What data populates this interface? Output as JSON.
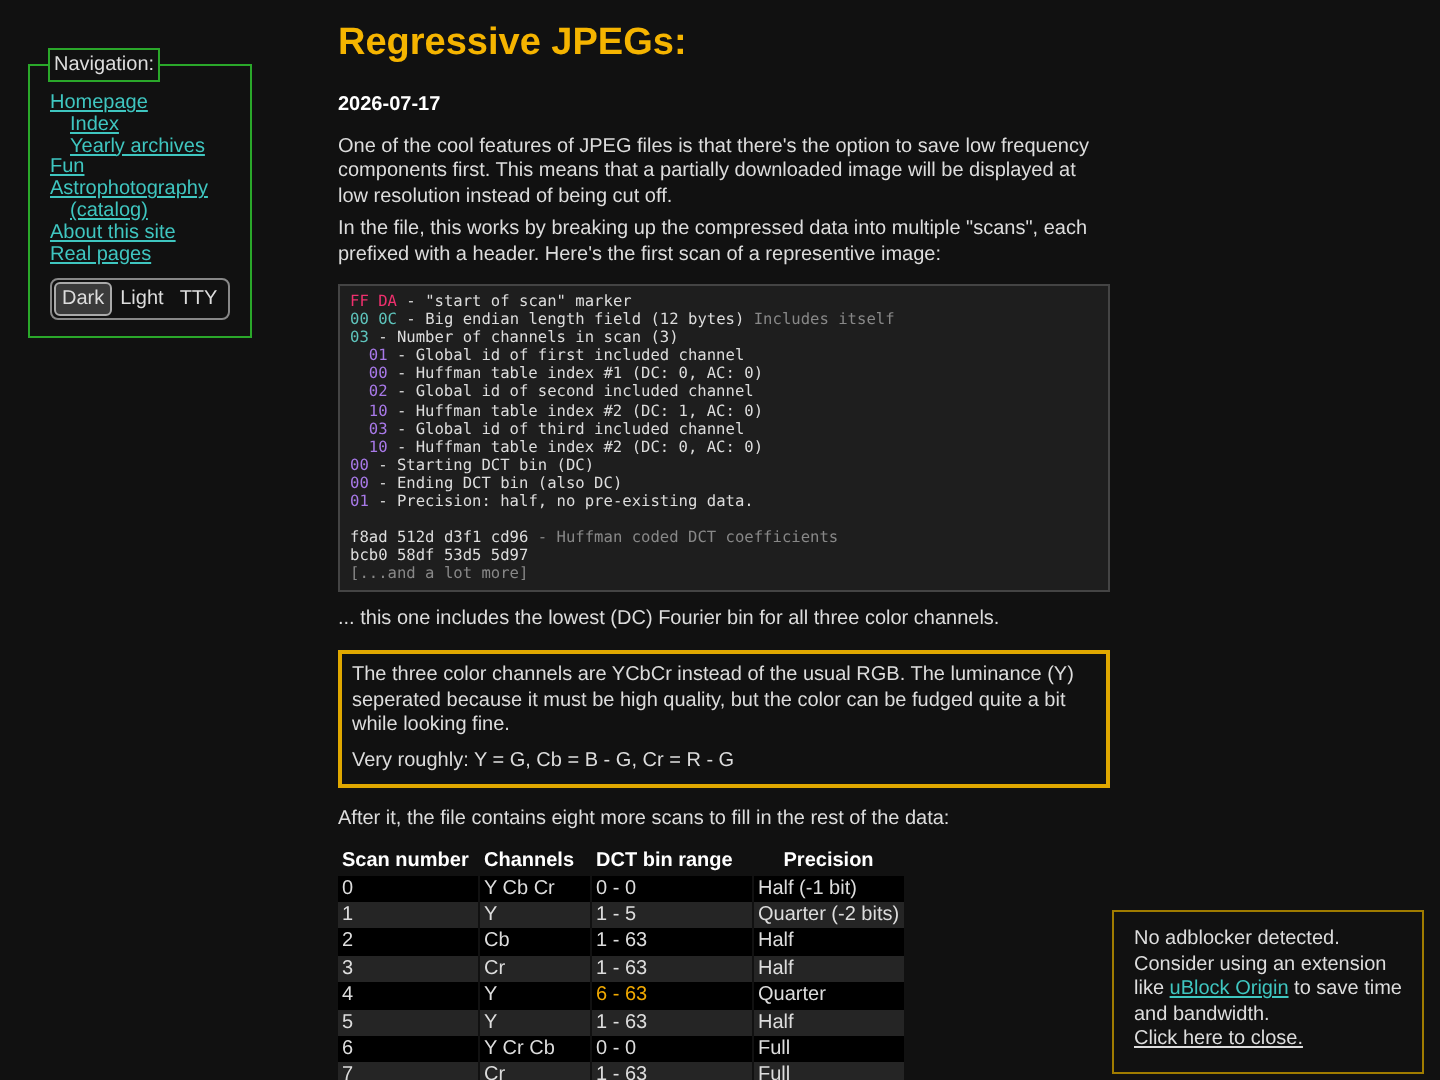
{
  "navigation": {
    "title": "Navigation:",
    "links": [
      {
        "label": "Homepage",
        "children": [
          {
            "label": "Index"
          },
          {
            "label": "Yearly archives"
          }
        ]
      },
      {
        "label": "Fun"
      },
      {
        "label": "Astrophotography",
        "children": [
          {
            "label": "(catalog)"
          }
        ]
      },
      {
        "label": "About this site"
      },
      {
        "label": "Real pages"
      }
    ],
    "themes": [
      {
        "label": "Dark",
        "selected": true
      },
      {
        "label": "Light",
        "selected": false
      },
      {
        "label": "TTY",
        "selected": false
      }
    ]
  },
  "article": {
    "title": "Regressive JPEGs:",
    "date": "2026-07-17",
    "intro": [
      "One of the cool features of JPEG files is that there's the option to save low frequency components first. This means that a partially downloaded image will be displayed at low resolution instead of being cut off.",
      "In the file, this works by breaking up the compressed data into multiple \"scans\", each prefixed with a header. Here's the first scan of a representive image:"
    ],
    "code": [
      {
        "kind": "field",
        "hex": "FF DA",
        "color": "#f0306e",
        "text": " - \"start of scan\" marker"
      },
      {
        "kind": "field",
        "hex": "00 0C",
        "color": "#5ec4bc",
        "text": " - Big endian length field (12 bytes)",
        "note": " Includes itself"
      },
      {
        "kind": "field",
        "hex": "03",
        "color": "#5ec4bc",
        "text": " - Number of channels in scan (3)",
        "children": [
          {
            "kind": "field",
            "hex": "01",
            "color": "#a879e8",
            "text": " - Global id of first included channel"
          },
          {
            "kind": "field",
            "hex": "00",
            "color": "#a879e8",
            "text": " - Huffman table index #1 (DC: 0, AC: 0)"
          },
          {
            "kind": "field",
            "hex": "02",
            "color": "#a879e8",
            "text": " - Global id of second included channel"
          },
          {
            "kind": "field",
            "hex": "10",
            "color": "#a879e8",
            "text": " - Huffman table index #2 (DC: 1, AC: 0)"
          },
          {
            "kind": "field",
            "hex": "03",
            "color": "#a879e8",
            "text": " - Global id of third included channel"
          },
          {
            "kind": "field",
            "hex": "10",
            "color": "#a879e8",
            "text": " - Huffman table index #2 (DC: 0, AC: 0)"
          }
        ]
      },
      {
        "kind": "field",
        "hex": "00",
        "color": "#a879e8",
        "text": " - Starting DCT bin (DC)"
      },
      {
        "kind": "field",
        "hex": "00",
        "color": "#a879e8",
        "text": " - Ending DCT bin (also DC)"
      },
      {
        "kind": "field",
        "hex": "01",
        "color": "#a879e8",
        "text": " - Precision: half, no pre-existing data."
      },
      {
        "kind": "blank"
      },
      {
        "kind": "data",
        "text": "f8ad 512d d3f1 cd96",
        "note": " - Huffman coded DCT coefficients"
      },
      {
        "kind": "data",
        "text": "bcb0 58df 53d5 5d97"
      },
      {
        "kind": "note",
        "text": "[...and a lot more]"
      }
    ],
    "after_code": "... this one includes the lowest (DC) Fourier bin for all three color channels.",
    "callout": [
      "The three color channels are YCbCr instead of the usual RGB. The luminance (Y) seperated because it must be high quality, but the color can be fudged quite a bit while looking fine.",
      "Very roughly: Y = G, Cb = B - G, Cr = R - G"
    ],
    "table_intro": "After it, the file contains eight more scans to fill in the rest of the data:",
    "table": {
      "columns": [
        "Scan number",
        "Channels",
        "DCT bin range",
        "Precision"
      ],
      "rows": [
        [
          {
            "text": "0",
            "highlighted": false
          },
          {
            "text": "Y Cb Cr",
            "highlighted": false
          },
          {
            "text": "0 - 0",
            "highlighted": false
          },
          {
            "text": "Half (-1 bit)",
            "highlighted": false
          }
        ],
        [
          {
            "text": "1",
            "highlighted": false
          },
          {
            "text": "Y",
            "highlighted": false
          },
          {
            "text": "1 - 5",
            "highlighted": false
          },
          {
            "text": "Quarter (-2 bits)",
            "highlighted": false
          }
        ],
        [
          {
            "text": "2",
            "highlighted": false
          },
          {
            "text": "Cb",
            "highlighted": false
          },
          {
            "text": "1 - 63",
            "highlighted": false
          },
          {
            "text": "Half",
            "highlighted": false
          }
        ],
        [
          {
            "text": "3",
            "highlighted": false
          },
          {
            "text": "Cr",
            "highlighted": false
          },
          {
            "text": "1 - 63",
            "highlighted": false
          },
          {
            "text": "Half",
            "highlighted": false
          }
        ],
        [
          {
            "text": "4",
            "highlighted": false
          },
          {
            "text": "Y",
            "highlighted": false
          },
          {
            "text": "6 - 63",
            "highlighted": true
          },
          {
            "text": "Quarter",
            "highlighted": false
          }
        ],
        [
          {
            "text": "5",
            "highlighted": false
          },
          {
            "text": "Y",
            "highlighted": false
          },
          {
            "text": "1 - 63",
            "highlighted": false
          },
          {
            "text": "Half",
            "highlighted": false
          }
        ],
        [
          {
            "text": "6",
            "highlighted": false
          },
          {
            "text": "Y Cr Cb",
            "highlighted": false
          },
          {
            "text": "0 - 0",
            "highlighted": false
          },
          {
            "text": "Full",
            "highlighted": false
          }
        ],
        [
          {
            "text": "7",
            "highlighted": false
          },
          {
            "text": "Cr",
            "highlighted": false
          },
          {
            "text": "1 - 63",
            "highlighted": false
          },
          {
            "text": "Full",
            "highlighted": false
          }
        ]
      ]
    }
  },
  "notice": {
    "lines": [
      "No adblocker detected. Consider using an extension like"
    ],
    "link": "uBlock Origin",
    "after_link": " to save time and bandwidth.",
    "close_link": "Click here to close."
  }
}
